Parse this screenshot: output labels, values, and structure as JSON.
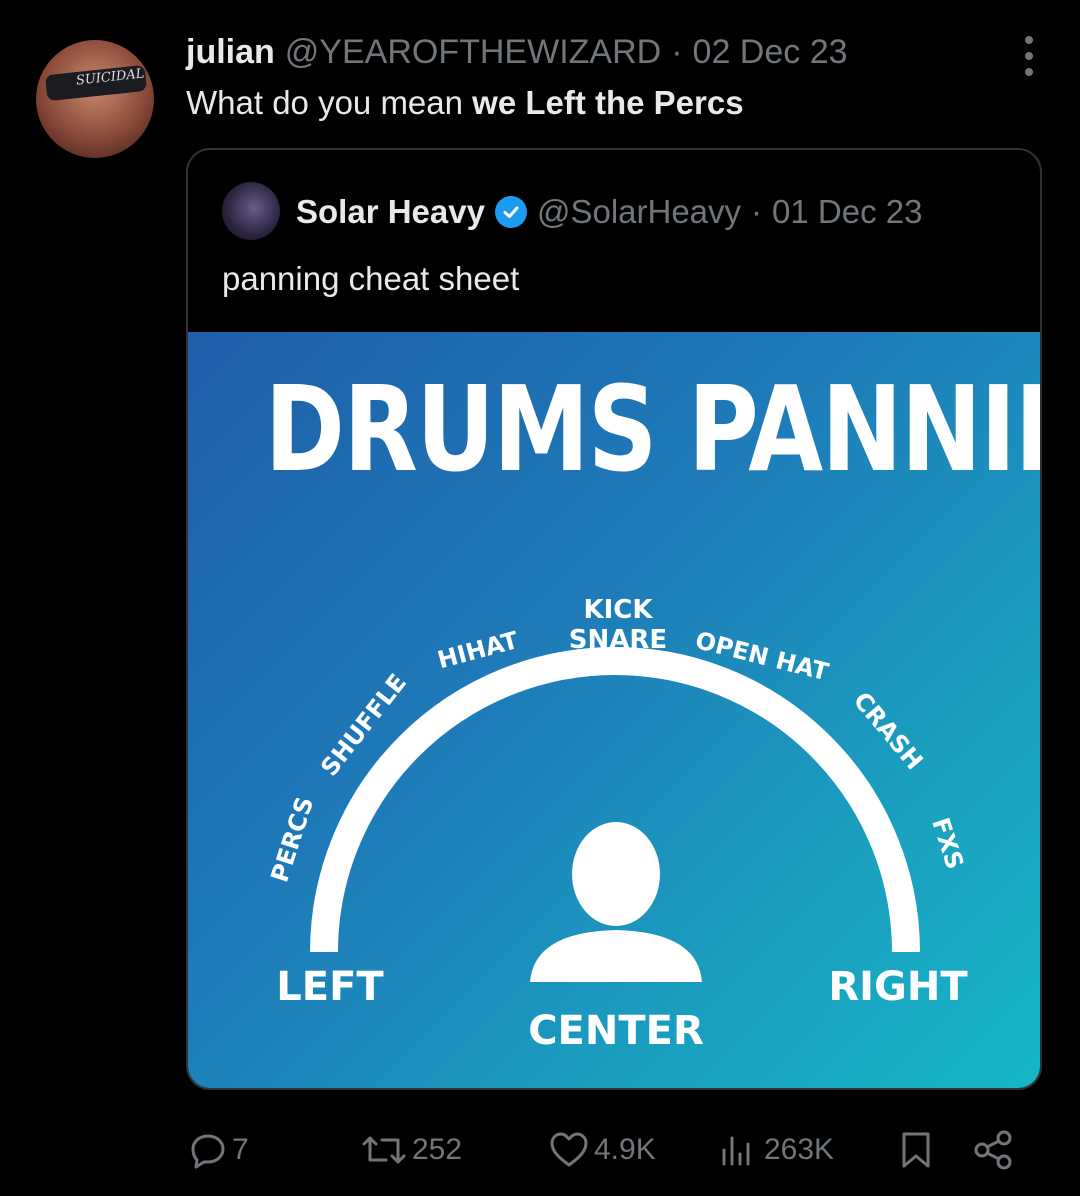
{
  "tweet": {
    "name": "julian",
    "handle": "@YEAROFTHEWIZARD",
    "separator": "·",
    "date": "02 Dec 23",
    "text_plain": "What do you mean ",
    "text_bold": "we Left the Percs",
    "avatar_text": "SUICIDAL"
  },
  "quote": {
    "name": "Solar Heavy",
    "handle": "@SolarHeavy",
    "separator": "·",
    "date": "01 Dec 23",
    "text": "panning cheat sheet",
    "image": {
      "title": "DRUMS PANNING",
      "labels": {
        "percs": "PERCS",
        "shuffle": "SHUFFLE",
        "hihat": "HIHAT",
        "kick": "KICK",
        "snare": "SNARE",
        "open_hat": "OPEN HAT",
        "crash": "CRASH",
        "fxs": "FXS"
      },
      "left": "LEFT",
      "center": "CENTER",
      "right": "RIGHT"
    }
  },
  "actions": {
    "replies": "7",
    "reposts": "252",
    "likes": "4.9K",
    "views": "263K"
  },
  "icons": [
    "more-icon",
    "verified-icon",
    "reply-icon",
    "repost-icon",
    "like-icon",
    "views-icon",
    "bookmark-icon",
    "share-icon"
  ]
}
